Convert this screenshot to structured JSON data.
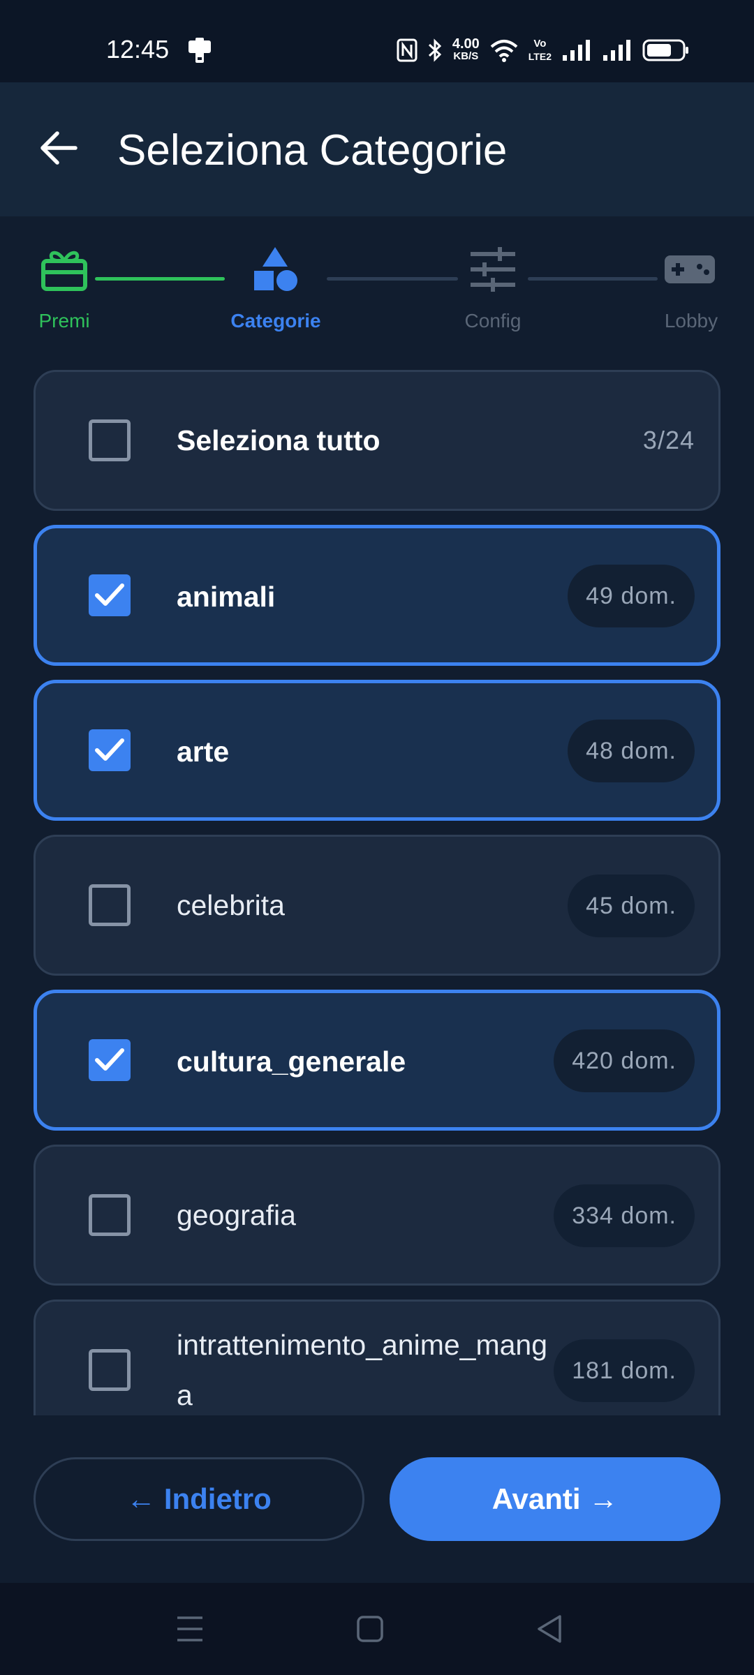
{
  "status": {
    "time": "12:45",
    "net_speed_value": "4.00",
    "net_speed_unit": "KB/S",
    "volte_top": "Vo",
    "volte_bottom": "LTE2"
  },
  "appbar": {
    "title": "Seleziona Categorie"
  },
  "stepper": {
    "steps": [
      {
        "label": "Premi",
        "state": "done",
        "icon": "gift-icon",
        "color": "#2fc25b"
      },
      {
        "label": "Categorie",
        "state": "active",
        "icon": "shapes-icon",
        "color": "#3c82f0"
      },
      {
        "label": "Config",
        "state": "pending",
        "icon": "sliders-icon",
        "color": "#5a6677"
      },
      {
        "label": "Lobby",
        "state": "pending",
        "icon": "gamepad-icon",
        "color": "#5a6677"
      }
    ]
  },
  "select_all": {
    "label": "Seleziona tutto",
    "count": "3/24",
    "checked": false
  },
  "categories": [
    {
      "name": "animali",
      "count": "49 dom.",
      "checked": true
    },
    {
      "name": "arte",
      "count": "48 dom.",
      "checked": true
    },
    {
      "name": "celebrita",
      "count": "45 dom.",
      "checked": false
    },
    {
      "name": "cultura_generale",
      "count": "420 dom.",
      "checked": true
    },
    {
      "name": "geografia",
      "count": "334 dom.",
      "checked": false
    },
    {
      "name": "intrattenimento_anime_manga",
      "count": "181 dom.",
      "checked": false
    }
  ],
  "footer": {
    "back_label": "← Indietro",
    "next_label": "Avanti →"
  },
  "colors": {
    "accent": "#3c82f0",
    "success": "#2fc25b",
    "background": "#111d2f"
  }
}
